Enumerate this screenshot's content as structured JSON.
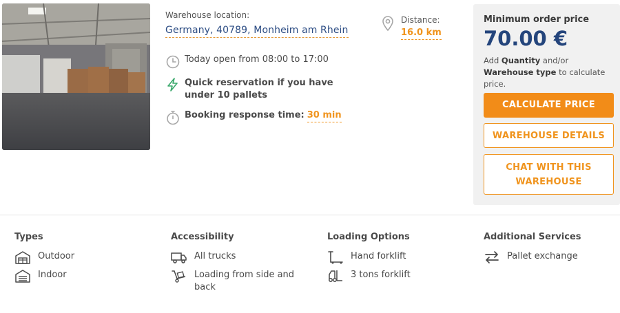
{
  "location": {
    "label": "Warehouse location:",
    "value": "Germany, 40789, Monheim am Rhein"
  },
  "distance": {
    "label": "Distance:",
    "value": "16.0 km"
  },
  "details": {
    "open_hours": "Today open from 08:00 to 17:00",
    "quick_reservation": "Quick reservation if you have under 10 pallets",
    "booking_label": "Booking response time:",
    "booking_value": "30 min"
  },
  "pricing": {
    "min_label": "Minimum order price",
    "price": "70.00 €",
    "note_prefix": "Add ",
    "note_qty": "Quantity",
    "note_mid": " and/or ",
    "note_type": "Warehouse type",
    "note_suffix": " to calculate price.",
    "calculate_label": "CALCULATE PRICE",
    "details_label": "WAREHOUSE DETAILS",
    "chat_line1": "CHAT WITH THIS",
    "chat_line2": "WAREHOUSE"
  },
  "features": {
    "types": {
      "title": "Types",
      "items": [
        {
          "label": "Outdoor",
          "icon": "warehouse-outdoor-icon"
        },
        {
          "label": "Indoor",
          "icon": "warehouse-indoor-icon"
        }
      ]
    },
    "accessibility": {
      "title": "Accessibility",
      "items": [
        {
          "label": "All trucks",
          "icon": "truck-icon"
        },
        {
          "label": "Loading from side and back",
          "icon": "hand-truck-icon"
        }
      ]
    },
    "loading": {
      "title": "Loading Options",
      "items": [
        {
          "label": "Hand forklift",
          "icon": "hand-forklift-icon"
        },
        {
          "label": "3 tons forklift",
          "icon": "forklift-icon"
        }
      ]
    },
    "services": {
      "title": "Additional Services",
      "items": [
        {
          "label": "Pallet exchange",
          "icon": "exchange-arrows-icon"
        }
      ]
    }
  },
  "colors": {
    "accent": "#f28c18",
    "price": "#24457c",
    "link": "#2d4d84",
    "quick_icon": "#3aa86b"
  }
}
